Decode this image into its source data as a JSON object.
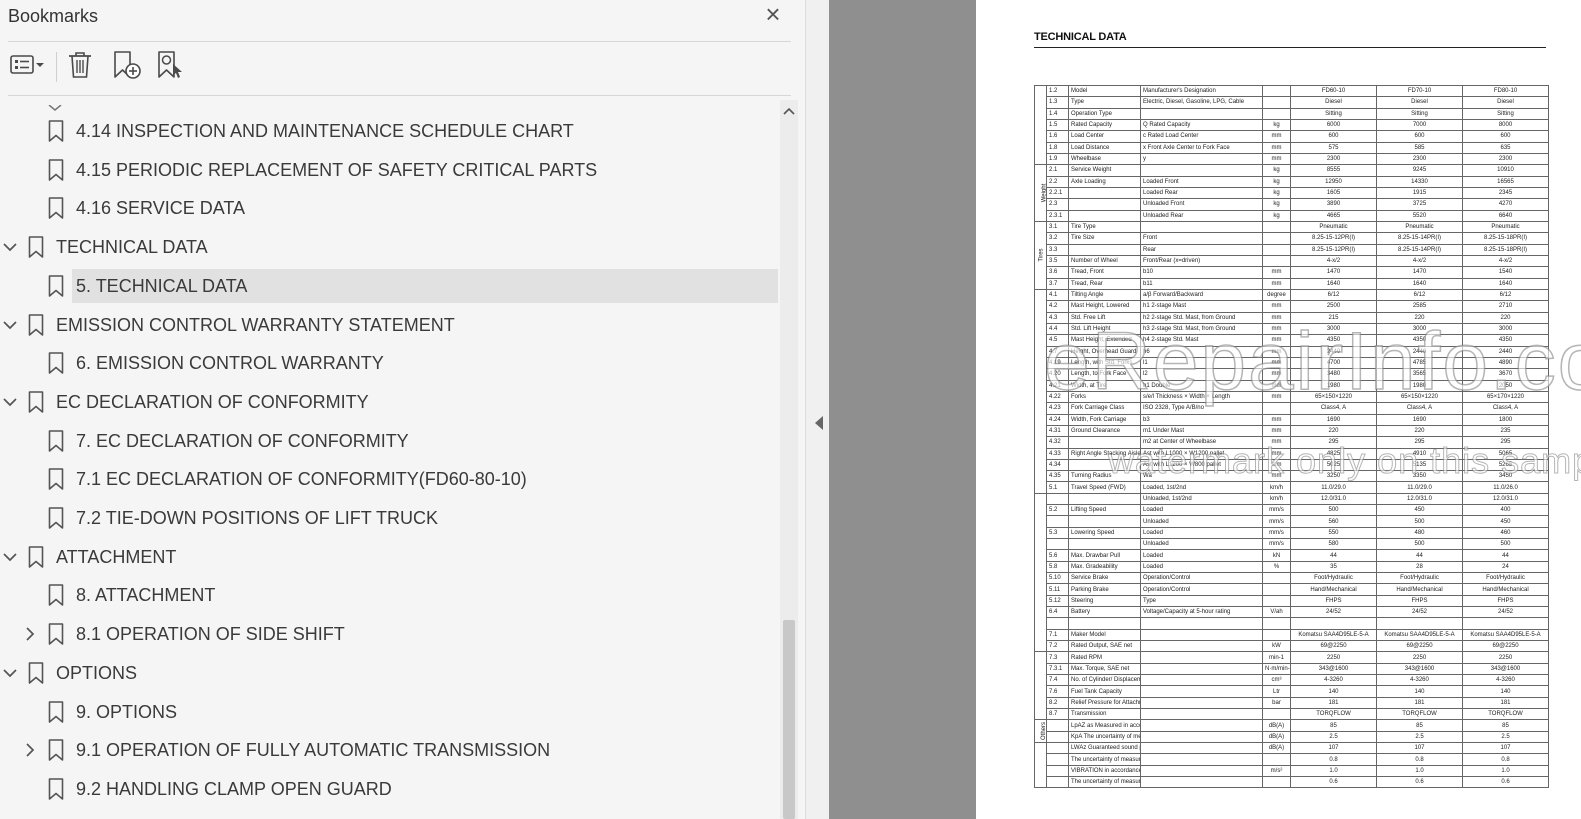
{
  "panel": {
    "title": "Bookmarks",
    "close_icon": "×"
  },
  "toolbar": {
    "options_icon": "list-options-icon",
    "delete_icon": "trash-icon",
    "new_icon": "new-bookmark-icon",
    "find_icon": "find-bookmark-icon"
  },
  "bookmarks": [
    {
      "label": "4.14 INSPECTION AND MAINTENANCE SCHEDULE CHART",
      "level": 1,
      "chevron": ""
    },
    {
      "label": "4.15 PERIODIC REPLACEMENT OF SAFETY CRITICAL PARTS",
      "level": 1,
      "chevron": ""
    },
    {
      "label": "4.16 SERVICE DATA",
      "level": 1,
      "chevron": ""
    },
    {
      "label": "TECHNICAL DATA",
      "level": 0,
      "chevron": "expanded"
    },
    {
      "label": "5. TECHNICAL DATA",
      "level": 1,
      "chevron": "",
      "selected": true
    },
    {
      "label": "EMISSION CONTROL WARRANTY STATEMENT",
      "level": 0,
      "chevron": "expanded"
    },
    {
      "label": "6. EMISSION CONTROL WARRANTY",
      "level": 1,
      "chevron": ""
    },
    {
      "label": "EC DECLARATION OF CONFORMITY",
      "level": 0,
      "chevron": "expanded"
    },
    {
      "label": "7. EC DECLARATION OF CONFORMITY",
      "level": 1,
      "chevron": ""
    },
    {
      "label": "7.1 EC DECLARATION OF CONFORMITY(FD60-80-10)",
      "level": 1,
      "chevron": ""
    },
    {
      "label": "7.2 TIE-DOWN POSITIONS OF LIFT TRUCK",
      "level": 1,
      "chevron": ""
    },
    {
      "label": "ATTACHMENT",
      "level": 0,
      "chevron": "expanded"
    },
    {
      "label": "8. ATTACHMENT",
      "level": 1,
      "chevron": ""
    },
    {
      "label": "8.1 OPERATION OF SIDE SHIFT",
      "level": 1,
      "chevron": "collapsed"
    },
    {
      "label": "OPTIONS",
      "level": 0,
      "chevron": "expanded"
    },
    {
      "label": "9. OPTIONS",
      "level": 1,
      "chevron": ""
    },
    {
      "label": "9.1 OPERATION OF FULLY AUTOMATIC TRANSMISSION",
      "level": 1,
      "chevron": "collapsed"
    },
    {
      "label": "9.2 HANDLING CLAMP OPEN GUARD",
      "level": 1,
      "chevron": ""
    }
  ],
  "document": {
    "title": "TECHNICAL DATA",
    "watermark_main": "eRepairInfo.com",
    "watermark_sub": "watermark only on this sample",
    "groups": [
      {
        "name": "Characteristics",
        "rows": 7
      },
      {
        "name": "Weight",
        "rows": 5
      },
      {
        "name": "Tires",
        "rows": 6
      },
      {
        "name": "Dimensions",
        "rows": 18
      },
      {
        "name": "Performance",
        "rows": 14
      },
      {
        "name": "I.C. Engine",
        "rows": 6
      },
      {
        "name": "Others",
        "rows": 2
      },
      {
        "name": "Noise Level",
        "rows": 4
      },
      {
        "name": "Vibration",
        "rows": 2
      }
    ],
    "rows": [
      [
        "1.2",
        "Model",
        "Manufacturer's Designation",
        "",
        "FD60-10",
        "FD70-10",
        "FD80-10"
      ],
      [
        "1.3",
        "Type",
        "Electric, Diesel, Gasoline, LPG, Cable",
        "",
        "Diesel",
        "Diesel",
        "Diesel"
      ],
      [
        "1.4",
        "Operation Type",
        "",
        "",
        "Sitting",
        "Sitting",
        "Sitting"
      ],
      [
        "1.5",
        "Rated Capacity",
        "Q   Rated Capacity",
        "kg",
        "6000",
        "7000",
        "8000"
      ],
      [
        "1.6",
        "Load Center",
        "c   Rated Load Center",
        "mm",
        "600",
        "600",
        "600"
      ],
      [
        "1.8",
        "Load Distance",
        "x   Front Axle Center to Fork Face",
        "mm",
        "575",
        "585",
        "635"
      ],
      [
        "1.9",
        "Wheelbase",
        "y",
        "mm",
        "2300",
        "2300",
        "2300"
      ],
      [
        "2.1",
        "Service Weight",
        "",
        "kg",
        "8555",
        "9245",
        "10910"
      ],
      [
        "2.2",
        "Axle Loading",
        "Loaded   Front",
        "kg",
        "12950",
        "14330",
        "16565"
      ],
      [
        "2.2.1",
        "",
        "Loaded   Rear",
        "kg",
        "1605",
        "1915",
        "2345"
      ],
      [
        "2.3",
        "",
        "Unloaded   Front",
        "kg",
        "3890",
        "3725",
        "4270"
      ],
      [
        "2.3.1",
        "",
        "Unloaded   Rear",
        "kg",
        "4665",
        "5520",
        "6640"
      ],
      [
        "3.1",
        "Tire Type",
        "",
        "",
        "Pneumatic",
        "Pneumatic",
        "Pneumatic"
      ],
      [
        "3.2",
        "Tire Size",
        "Front",
        "",
        "8.25-15-12PR(I)",
        "8.25-15-14PR(I)",
        "8.25-15-18PR(I)"
      ],
      [
        "3.3",
        "",
        "Rear",
        "",
        "8.25-15-12PR(I)",
        "8.25-15-14PR(I)",
        "8.25-15-18PR(I)"
      ],
      [
        "3.5",
        "Number of Wheel",
        "Front/Rear (x=driven)",
        "",
        "4-x/2",
        "4-x/2",
        "4-x/2"
      ],
      [
        "3.6",
        "Tread, Front",
        "b10",
        "mm",
        "1470",
        "1470",
        "1540"
      ],
      [
        "3.7",
        "Tread, Rear",
        "b11",
        "mm",
        "1640",
        "1640",
        "1640"
      ],
      [
        "4.1",
        "Tilting Angle",
        "a/β   Forward/Backward",
        "degree",
        "6/12",
        "6/12",
        "6/12"
      ],
      [
        "4.2",
        "Mast Height, Lowered",
        "h1   2-stage Mast",
        "mm",
        "2500",
        "2585",
        "2710"
      ],
      [
        "4.3",
        "Std. Free Lift",
        "h2   2-stage Std. Mast, from Ground",
        "mm",
        "215",
        "220",
        "220"
      ],
      [
        "4.4",
        "Std. Lift Height",
        "h3   2-stage Std. Mast, from Ground",
        "mm",
        "3000",
        "3000",
        "3000"
      ],
      [
        "4.5",
        "Mast Height, Extended",
        "h4   2-stage Std. Mast",
        "mm",
        "4350",
        "4350",
        "4350"
      ],
      [
        "4.7",
        "Height, Overhead Guard",
        "h6",
        "mm",
        "2440",
        "2440",
        "2440"
      ],
      [
        "4.19",
        "Length, with Std. Forks",
        "l1",
        "mm",
        "4700",
        "4785",
        "4890"
      ],
      [
        "4.20",
        "Length, to Fork Face",
        "l2",
        "mm",
        "3480",
        "3565",
        "3670"
      ],
      [
        "4.21",
        "Width, at Tire",
        "b1   Double",
        "mm",
        "1980",
        "1980",
        "2050"
      ],
      [
        "4.22",
        "Forks",
        "s/e/l   Thickness × Width × Length",
        "mm",
        "65×150×1220",
        "65×150×1220",
        "65×170×1220"
      ],
      [
        "4.23",
        "Fork Carriage Class",
        "ISO 2328, Type A/B/no",
        "",
        "Class4, A",
        "Class4, A",
        "Class4, A"
      ],
      [
        "4.24",
        "Width, Fork Carriage",
        "b3",
        "mm",
        "1690",
        "1690",
        "1800"
      ],
      [
        "4.31",
        "Ground Clearance",
        "m1   Under Mast",
        "mm",
        "220",
        "220",
        "235"
      ],
      [
        "4.32",
        "",
        "m2   at Center of Wheelbase",
        "mm",
        "295",
        "295",
        "295"
      ],
      [
        "4.33",
        "Right Angle Stacking Aisle",
        "Ast   with L1000 × W1200 pallet",
        "mm",
        "4825",
        "4910",
        "5065"
      ],
      [
        "4.34",
        "",
        "Ast   with L1200 × W800 pallet",
        "mm",
        "5025",
        "5135",
        "5265"
      ],
      [
        "4.35",
        "Turning Radius",
        "Wa",
        "mm",
        "3250",
        "3350",
        "3450"
      ],
      [
        "5.1",
        "Travel Speed (FWD)",
        "Loaded, 1st/2nd",
        "km/h",
        "11.0/29.0",
        "11.0/29.0",
        "11.0/26.0"
      ],
      [
        "",
        "",
        "Unloaded, 1st/2nd",
        "km/h",
        "12.0/31.0",
        "12.0/31.0",
        "12.0/31.0"
      ],
      [
        "5.2",
        "Lifting Speed",
        "Loaded",
        "mm/s",
        "500",
        "450",
        "400"
      ],
      [
        "",
        "",
        "Unloaded",
        "mm/s",
        "560",
        "500",
        "450"
      ],
      [
        "5.3",
        "Lowering Speed",
        "Loaded",
        "mm/s",
        "550",
        "480",
        "460"
      ],
      [
        "",
        "",
        "Unloaded",
        "mm/s",
        "580",
        "500",
        "500"
      ],
      [
        "5.6",
        "Max. Drawbar Pull",
        "Loaded",
        "kN",
        "44",
        "44",
        "44"
      ],
      [
        "5.8",
        "Max. Gradeability",
        "Loaded",
        "%",
        "35",
        "28",
        "24"
      ],
      [
        "5.10",
        "Service Brake",
        "Operation/Control",
        "",
        "Foot/Hydraulic",
        "Foot/Hydraulic",
        "Foot/Hydraulic"
      ],
      [
        "5.11",
        "Parking Brake",
        "Operation/Control",
        "",
        "Hand/Mechanical",
        "Hand/Mechanical",
        "Hand/Mechanical"
      ],
      [
        "5.12",
        "Steering",
        "Type",
        "",
        "FHPS",
        "FHPS",
        "FHPS"
      ],
      [
        "6.4",
        "Battery",
        "Voltage/Capacity at 5-hour rating",
        "V/ah",
        "24/52",
        "24/52",
        "24/52"
      ],
      [
        "",
        "",
        "",
        "",
        "",
        "",
        ""
      ],
      [
        "7.1",
        "Maker Model",
        "",
        "",
        "Komatsu SAA4D95LE-5-A",
        "Komatsu SAA4D95LE-5-A",
        "Komatsu SAA4D95LE-5-A"
      ],
      [
        "7.2",
        "Rated Output, SAE net",
        "",
        "kW",
        "69@2250",
        "69@2250",
        "69@2250"
      ],
      [
        "7.3",
        "Rated RPM",
        "",
        "min-1",
        "2250",
        "2250",
        "2250"
      ],
      [
        "7.3.1",
        "Max. Torque, SAE net",
        "",
        "N·m/min-1",
        "343@1600",
        "343@1600",
        "343@1600"
      ],
      [
        "7.4",
        "No. of Cylinder/ Displacement",
        "",
        "cm³",
        "4-3260",
        "4-3260",
        "4-3260"
      ],
      [
        "7.6",
        "Fuel Tank Capacity",
        "",
        "Ltr",
        "140",
        "140",
        "140"
      ],
      [
        "8.2",
        "Relief Pressure for Attachment",
        "",
        "bar",
        "181",
        "181",
        "181"
      ],
      [
        "8.7",
        "Transmission",
        "",
        "",
        "TORQFLOW",
        "TORQFLOW",
        "TORQFLOW"
      ],
      [
        "",
        "LpAZ as Measured in accordance with EN12053",
        "",
        "dB(A)",
        "85",
        "85",
        "85"
      ],
      [
        "",
        "KpA The uncertainty of measurement in accordance with EN12053",
        "",
        "dB(A)",
        "2.5",
        "2.5",
        "2.5"
      ],
      [
        "",
        "LWAz Guaranteed sound power level accordance with 2000/14/EC",
        "",
        "dB(A)",
        "107",
        "107",
        "107"
      ],
      [
        "",
        "The uncertainty of measurement",
        "",
        "",
        "0.8",
        "0.8",
        "0.8"
      ],
      [
        "",
        "VIBRATION in accordance with EN 13059",
        "",
        "m/s²",
        "1.0",
        "1.0",
        "1.0"
      ],
      [
        "",
        "The uncertainty of measurement",
        "",
        "",
        "0.6",
        "0.6",
        "0.6"
      ]
    ]
  }
}
